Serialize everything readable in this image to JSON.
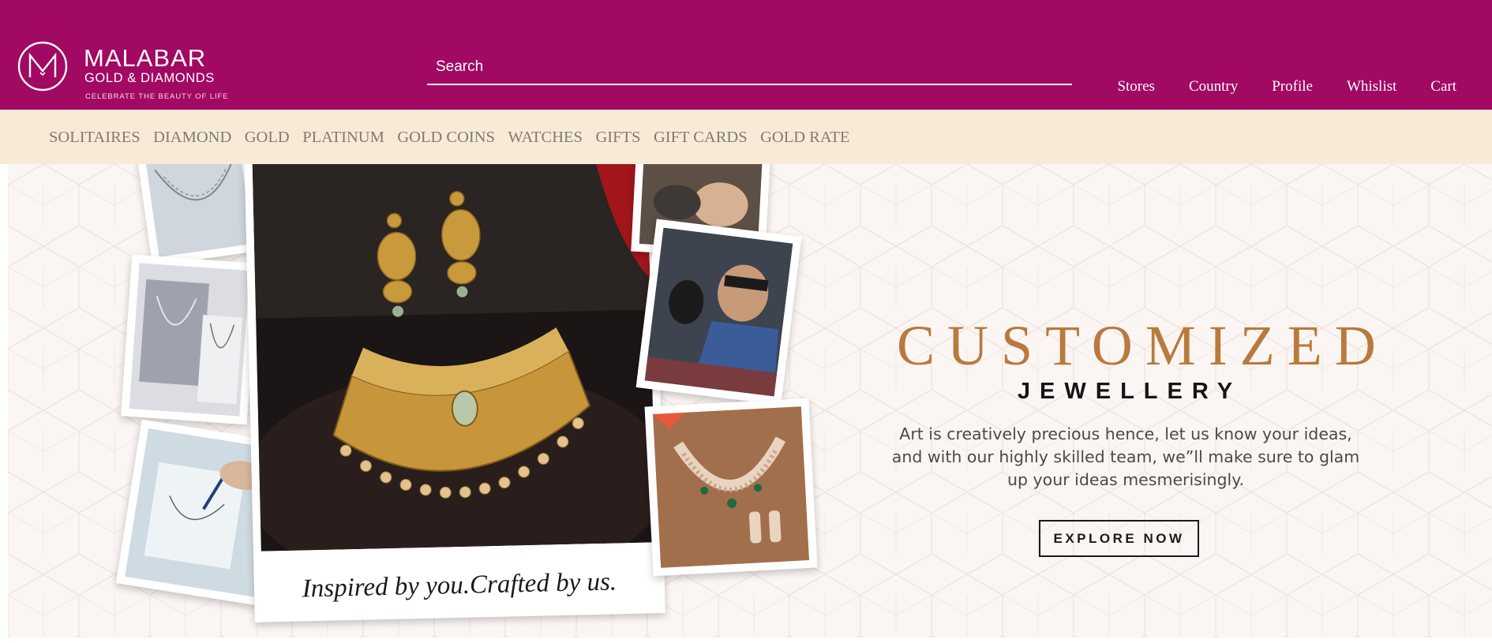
{
  "brand": {
    "name": "MALABAR",
    "subtitle": "GOLD & DIAMONDS",
    "tagline": "CELEBRATE THE BEAUTY OF LIFE",
    "color": "#a10963"
  },
  "search": {
    "placeholder": "Search"
  },
  "header_links": [
    "Stores",
    "Country",
    "Profile",
    "Whislist",
    "Cart"
  ],
  "categories": [
    "SOLITAIRES",
    "DIAMOND",
    "GOLD",
    "PLATINUM",
    "GOLD COINS",
    "WATCHES",
    "GIFTS",
    "GIFT CARDS",
    "GOLD RATE"
  ],
  "banner": {
    "headline": "CUSTOMIZED",
    "subheadline": "JEWELLERY",
    "description": "Art is creatively precious hence, let us know your ideas, and with our highly skilled team, we”ll make sure to glam up your ideas mesmerisingly.",
    "cta": "EXPLORE NOW",
    "photo_caption": "Inspired by you.Crafted by us.",
    "accent_color": "#b87a3d",
    "background": "#fbf6f3"
  }
}
